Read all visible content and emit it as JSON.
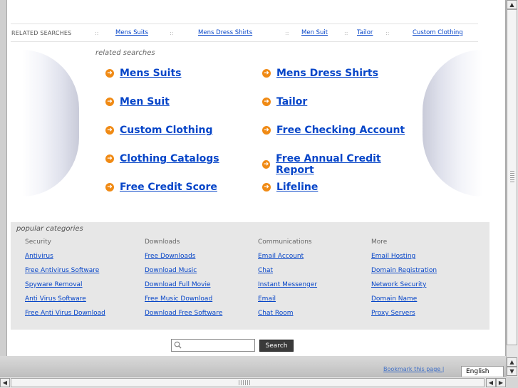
{
  "related_bar": {
    "title": "RELATED SEARCHES",
    "links": [
      "Mens Suits",
      "Mens Dress Shirts",
      "Men Suit",
      "Tailor",
      "Custom Clothing"
    ],
    "separator": "::"
  },
  "related_searches": {
    "title": "related searches",
    "links": [
      "Mens Suits",
      "Mens Dress Shirts",
      "Men Suit",
      "Tailor",
      "Custom Clothing",
      "Free Checking Account",
      "Clothing Catalogs",
      "Free Annual Credit Report",
      "Free Credit Score",
      "Lifeline"
    ]
  },
  "popular": {
    "title": "popular categories",
    "columns": [
      {
        "heading": "Security",
        "links": [
          "Antivirus",
          "Free Antivirus Software",
          "Spyware Removal",
          "Anti Virus Software",
          "Free Anti Virus Download"
        ]
      },
      {
        "heading": "Downloads",
        "links": [
          "Free Downloads",
          "Download Music",
          "Download Full Movie",
          "Free Music Download",
          "Download Free Software"
        ]
      },
      {
        "heading": "Communications",
        "links": [
          "Email Account",
          "Chat",
          "Instant Messenger",
          "Email",
          "Chat Room"
        ]
      },
      {
        "heading": "More",
        "links": [
          "Email Hosting",
          "Domain Registration",
          "Network Security",
          "Domain Name",
          "Proxy Servers"
        ]
      }
    ]
  },
  "search": {
    "button_label": "Search",
    "value": ""
  },
  "footer": {
    "bookmark_label": "Bookmark this page |",
    "language": "English"
  },
  "icons": {
    "arrow": "circle-arrow-right-icon",
    "search": "magnifier-icon"
  },
  "colors": {
    "link": "#0645c8",
    "arrow": "#f08a14",
    "button": "#3a3a3a"
  }
}
